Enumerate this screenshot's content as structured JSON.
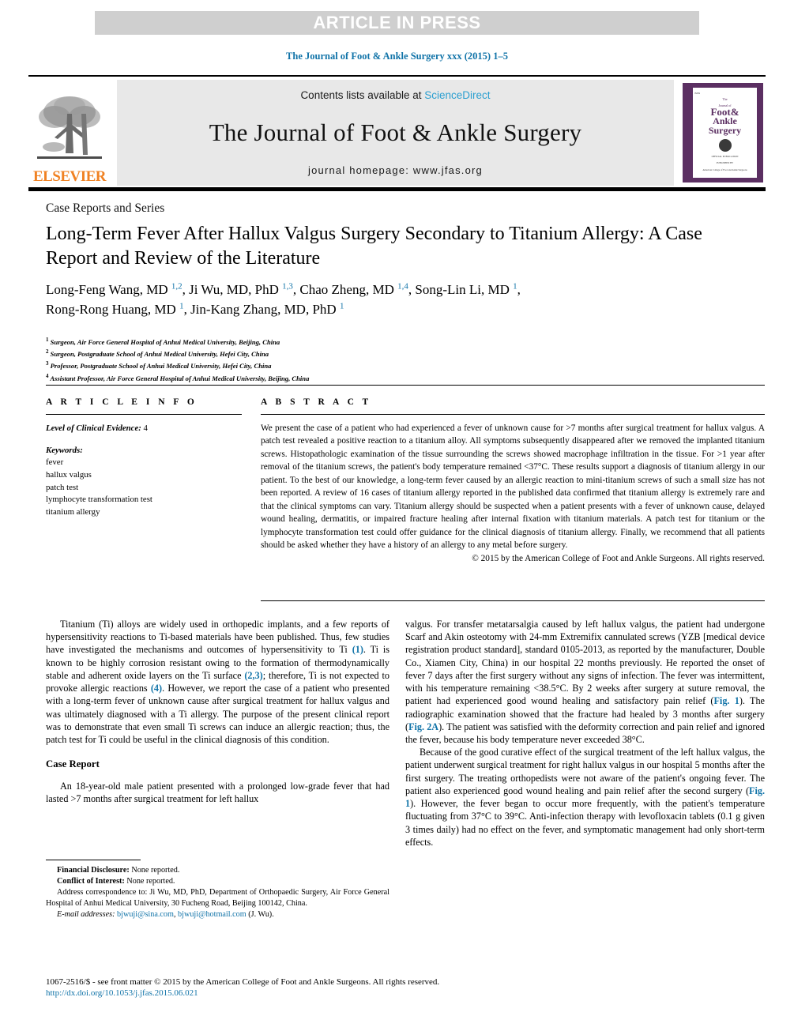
{
  "banner": {
    "text": "ARTICLE IN PRESS",
    "bg_color": "#cfcfcf",
    "text_color": "#ffffff"
  },
  "citation": {
    "text": "The Journal of Foot & Ankle Surgery xxx (2015) 1–5",
    "color": "#1073a8"
  },
  "masthead": {
    "publisher_name": "ELSEVIER",
    "publisher_color": "#f08122",
    "contents_prefix": "Contents lists available at ",
    "contents_link": "ScienceDirect",
    "contents_link_color": "#2a9fd0",
    "journal_title": "The Journal of Foot & Ankle Surgery",
    "homepage": "journal homepage: www.jfas.org",
    "cover": {
      "tag": "ISSN",
      "line_the": "The",
      "line_journal": "Journal of",
      "line1": "Foot&",
      "line2": "Ankle",
      "line3": "Surgery",
      "seal_caption": "OFFICIAL PUBLICATION",
      "footer1": "PUBLISHED BY",
      "footer2": "American College of Foot and Ankle Surgeons"
    }
  },
  "article": {
    "section_label": "Case Reports and Series",
    "title": "Long-Term Fever After Hallux Valgus Surgery Secondary to Titanium Allergy: A Case Report and Review of the Literature",
    "authors_line1_parts": [
      {
        "name": "Long-Feng Wang, MD ",
        "sup": "1,2"
      },
      {
        "name": ", Ji Wu, MD, PhD ",
        "sup": "1,3"
      },
      {
        "name": ", Chao Zheng, MD ",
        "sup": "1,4"
      },
      {
        "name": ", Song-Lin Li, MD ",
        "sup": "1"
      },
      {
        "name": ",",
        "sup": ""
      }
    ],
    "authors_line2_parts": [
      {
        "name": "Rong-Rong Huang, MD ",
        "sup": "1"
      },
      {
        "name": ", Jin-Kang Zhang, MD, PhD ",
        "sup": "1"
      }
    ],
    "affiliations": [
      {
        "marker": "1",
        "text": "Surgeon, Air Force General Hospital of Anhui Medical University, Beijing, China"
      },
      {
        "marker": "2",
        "text": "Surgeon, Postgraduate School of Anhui Medical University, Hefei City, China"
      },
      {
        "marker": "3",
        "text": "Professor, Postgraduate School of Anhui Medical University, Hefei City, China"
      },
      {
        "marker": "4",
        "text": "Assistant Professor, Air Force General Hospital of Anhui Medical University, Beijing, China"
      }
    ]
  },
  "article_info": {
    "heading": "A R T I C L E    I N F O",
    "evidence_label": "Level of Clinical Evidence:",
    "evidence_value": "4",
    "keywords_label": "Keywords:",
    "keywords": [
      "fever",
      "hallux valgus",
      "patch test",
      "lymphocyte transformation test",
      "titanium allergy"
    ]
  },
  "abstract": {
    "heading": "A B S T R A C T",
    "body": "We present the case of a patient who had experienced a fever of unknown cause for >7 months after surgical treatment for hallux valgus. A patch test revealed a positive reaction to a titanium alloy. All symptoms subsequently disappeared after we removed the implanted titanium screws. Histopathologic examination of the tissue surrounding the screws showed macrophage infiltration in the tissue. For >1 year after removal of the titanium screws, the patient's body temperature remained <37°C. These results support a diagnosis of titanium allergy in our patient. To the best of our knowledge, a long-term fever caused by an allergic reaction to mini-titanium screws of such a small size has not been reported. A review of 16 cases of titanium allergy reported in the published data confirmed that titanium allergy is extremely rare and that the clinical symptoms can vary. Titanium allergy should be suspected when a patient presents with a fever of unknown cause, delayed wound healing, dermatitis, or impaired fracture healing after internal fixation with titanium materials. A patch test for titanium or the lymphocyte transformation test could offer guidance for the clinical diagnosis of titanium allergy. Finally, we recommend that all patients should be asked whether they have a history of an allergy to any metal before surgery.",
    "copyright": "© 2015 by the American College of Foot and Ankle Surgeons. All rights reserved."
  },
  "body": {
    "left_paragraph_1_a": "Titanium (Ti) alloys are widely used in orthopedic implants, and a few reports of hypersensitivity reactions to Ti-based materials have been published. Thus, few studies have investigated the mechanisms and outcomes of hypersensitivity to Ti ",
    "left_ref_1": "(1)",
    "left_paragraph_1_b": ". Ti is known to be highly corrosion resistant owing to the formation of thermodynamically stable and adherent oxide layers on the Ti surface ",
    "left_ref_2": "(2,3)",
    "left_paragraph_1_c": "; therefore, Ti is not expected to provoke allergic reactions ",
    "left_ref_3": "(4)",
    "left_paragraph_1_d": ". However, we report the case of a patient who presented with a long-term fever of unknown cause after surgical treatment for hallux valgus and was ultimately diagnosed with a Ti allergy. The purpose of the present clinical report was to demonstrate that even small Ti screws can induce an allergic reaction; thus, the patch test for Ti could be useful in the clinical diagnosis of this condition.",
    "case_report_heading": "Case Report",
    "left_paragraph_2": "An 18-year-old male patient presented with a prolonged low-grade fever that had lasted >7 months after surgical treatment for left hallux",
    "right_paragraph_1_a": "valgus. For transfer metatarsalgia caused by left hallux valgus, the patient had undergone Scarf and Akin osteotomy with 24-mm Extremifix cannulated screws (YZB [medical device registration product standard], standard 0105-2013, as reported by the manufacturer, Double Co., Xiamen City, China) in our hospital 22 months previously. He reported the onset of fever 7 days after the first surgery without any signs of infection. The fever was intermittent, with his temperature remaining <38.5°C. By 2 weeks after surgery at suture removal, the patient had experienced good wound healing and satisfactory pain relief ",
    "right_ref_1": "Fig. 1",
    "right_paragraph_1_b": ". The radiographic examination showed that the fracture had healed by 3 months after surgery (",
    "right_ref_2": "Fig. 2A",
    "right_paragraph_1_c": "). The patient was satisfied with the deformity correction and pain relief and ignored the fever, because his body temperature never exceeded 38°C.",
    "right_paragraph_2_a": "Because of the good curative effect of the surgical treatment of the left hallux valgus, the patient underwent surgical treatment for right hallux valgus in our hospital 5 months after the first surgery. The treating orthopedists were not aware of the patient's ongoing fever. The patient also experienced good wound healing and pain relief after the second surgery (",
    "right_ref_3": "Fig. 1",
    "right_paragraph_2_b": "). However, the fever began to occur more frequently, with the patient's temperature fluctuating from 37°C to 39°C. Anti-infection therapy with levofloxacin tablets (0.1 g given 3 times daily) had no effect on the fever, and symptomatic management had only short-term effects."
  },
  "footnotes": {
    "financial_label": "Financial Disclosure:",
    "financial_value": "None reported.",
    "conflict_label": "Conflict of Interest:",
    "conflict_value": "None reported.",
    "address_text": "Address correspondence to: Ji Wu, MD, PhD, Department of Orthopaedic Surgery, Air Force General Hospital of Anhui Medical University, 30 Fucheng Road, Beijing 100142, China.",
    "email_label": "E-mail addresses:",
    "email_1": "bjwuji@sina.com",
    "email_2": "bjwuji@hotmail.com",
    "email_attrib": "(J. Wu)."
  },
  "footer": {
    "issn_line": "1067-2516/$ - see front matter © 2015 by the American College of Foot and Ankle Surgeons. All rights reserved.",
    "doi": "http://dx.doi.org/10.1053/j.jfas.2015.06.021",
    "link_color": "#1073a8"
  }
}
